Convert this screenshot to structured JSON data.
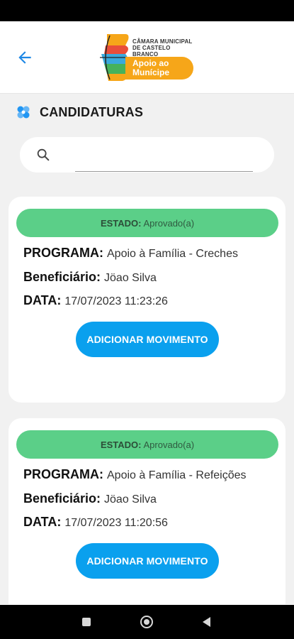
{
  "header": {
    "logo_org": "CÂMARA MUNICIPAL\nDE CASTELO BRANCO",
    "logo_app": "Apoio ao\nMunícipe"
  },
  "section": {
    "title": "CANDIDATURAS"
  },
  "search": {
    "value": "",
    "placeholder": ""
  },
  "cards": [
    {
      "estado_label": "ESTADO:",
      "estado_value": "Aprovado(a)",
      "programa_label": "PROGRAMA:",
      "programa_value": "Apoio à Família - Creches",
      "beneficiario_label": "Beneficiário:",
      "beneficiario_value": "Jöao Silva",
      "data_label": "DATA:",
      "data_value": "17/07/2023 11:23:26",
      "action_label": "ADICIONAR MOVIMENTO"
    },
    {
      "estado_label": "ESTADO:",
      "estado_value": "Aprovado(a)",
      "programa_label": "PROGRAMA:",
      "programa_value": "Apoio à Família - Refeições",
      "beneficiario_label": "Beneficiário:",
      "beneficiario_value": "Jöao Silva",
      "data_label": "DATA:",
      "data_value": "17/07/2023 11:20:56",
      "action_label": "ADICIONAR MOVIMENTO"
    }
  ],
  "colors": {
    "accent_blue": "#0aa0ee",
    "status_green": "#5bcf88",
    "logo_orange": "#f6a619"
  },
  "icons": {
    "back": "arrow-left-icon",
    "section": "flower-icon",
    "search": "search-icon"
  }
}
